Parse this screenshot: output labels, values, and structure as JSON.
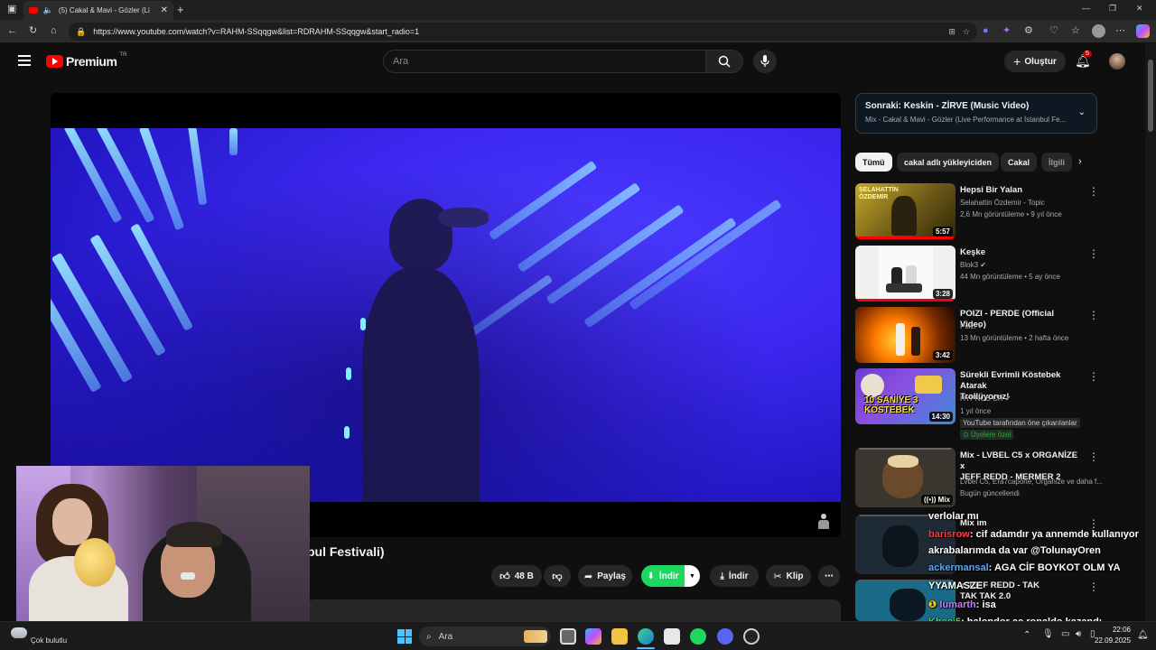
{
  "browser": {
    "tab_title": "(5) Cakal & Mavi - Gözler (Li",
    "url": "https://www.youtube.com/watch?v=RAHM-SSqqgw&list=RDRAHM-SSqqgw&start_radio=1"
  },
  "header": {
    "logo_text": "Premium",
    "logo_badge": "TR",
    "search_placeholder": "Ara",
    "create_label": "Oluştur",
    "notification_count": "5"
  },
  "video": {
    "title_fragment": "bul Festivali)",
    "like_count": "48 B",
    "share_label": "Paylaş",
    "download_primary": "İndir",
    "download_secondary": "İndir",
    "clip_label": "Klip"
  },
  "sidebar": {
    "next_up": "Sonraki: Keskin - ZİRVE (Music Video)",
    "next_sub": "Mix - Cakal & Mavi - Gözler (Live Performance at İstanbul Fe...",
    "chips": [
      "Tümü",
      "cakal adlı yükleyiciden",
      "Cakal",
      "İlgili"
    ],
    "recommendations": [
      {
        "title_line1": "Hepsi Bir Yalan",
        "title_line2": "",
        "channel": "Selahattin Özdemir - Topic",
        "meta": "2,6 Mn görüntüleme • 9 yıl önce",
        "duration": "5:57",
        "thumb_text": "SELAHATTİN ÖZDEMİR",
        "extra1": "",
        "extra2": ""
      },
      {
        "title_line1": "Keşke",
        "title_line2": "",
        "channel": "Blok3",
        "meta": "44 Mn görüntüleme • 5 ay önce",
        "duration": "3:28",
        "thumb_text": "",
        "extra1": "",
        "extra2": ""
      },
      {
        "title_line1": "POIZI - PERDE (Official Video)",
        "title_line2": "",
        "channel": "Poizi",
        "meta": "13 Mn görüntüleme • 2 hafta önce",
        "duration": "3:42",
        "thumb_text": "",
        "extra1": "",
        "extra2": ""
      },
      {
        "title_line1": "Sürekli Evrimli Köstebek Atarak",
        "title_line2": "Trollüyoruz!",
        "channel": "HYPNOS CR",
        "meta": "1 yıl önce",
        "duration": "14:30",
        "thumb_text": "10 SANİYE 3 KÖSTEBEK",
        "extra1": "YouTube tarafından öne çıkarılanlar",
        "extra2": "Üyelere özel"
      },
      {
        "title_line1": "Mix - LVBEL C5 x ORGANİZE x",
        "title_line2": "JEFF REDD - MERMER 2",
        "channel": "Lvbel C5, Era7capone, Organize ve daha f...",
        "meta": "Bugün güncellendi",
        "duration": "Mix",
        "thumb_text": "",
        "extra1": "",
        "extra2": ""
      },
      {
        "title_line1": "Mix im",
        "title_line2": "",
        "channel": "",
        "meta": "",
        "duration": "",
        "thumb_text": "",
        "extra1": "",
        "extra2": ""
      },
      {
        "title_line1": "x JEFF REDD - TAK",
        "title_line2": "TAK TAK 2.0",
        "channel": "",
        "meta": "",
        "duration": "",
        "thumb_text": "",
        "extra1": "",
        "extra2": ""
      }
    ]
  },
  "chat": [
    {
      "user": "",
      "text": "verlolar mı"
    },
    {
      "user": "barisrow",
      "text": ": cif adamdır ya annemde kullanıyor"
    },
    {
      "user": "",
      "text": "akrabalarımda da var @TolunayOren"
    },
    {
      "user": "ackermansal",
      "text": ": AGA CİF BOYKOT OLM YA"
    },
    {
      "user": "",
      "text": "YYAMASZE"
    },
    {
      "user": "lumarth",
      "text": ": isa"
    },
    {
      "user": "Kheci5",
      "text": ": balondor aç ronaldo kazandı"
    }
  ],
  "taskbar": {
    "weather": "Çok bulutlu",
    "search_label": "Ara",
    "time": "22:06",
    "date": "22.09.2025"
  },
  "colors": {
    "accent_red": "#ff0000",
    "download_green": "#1ed760",
    "video_blue": "#3c28f0"
  }
}
